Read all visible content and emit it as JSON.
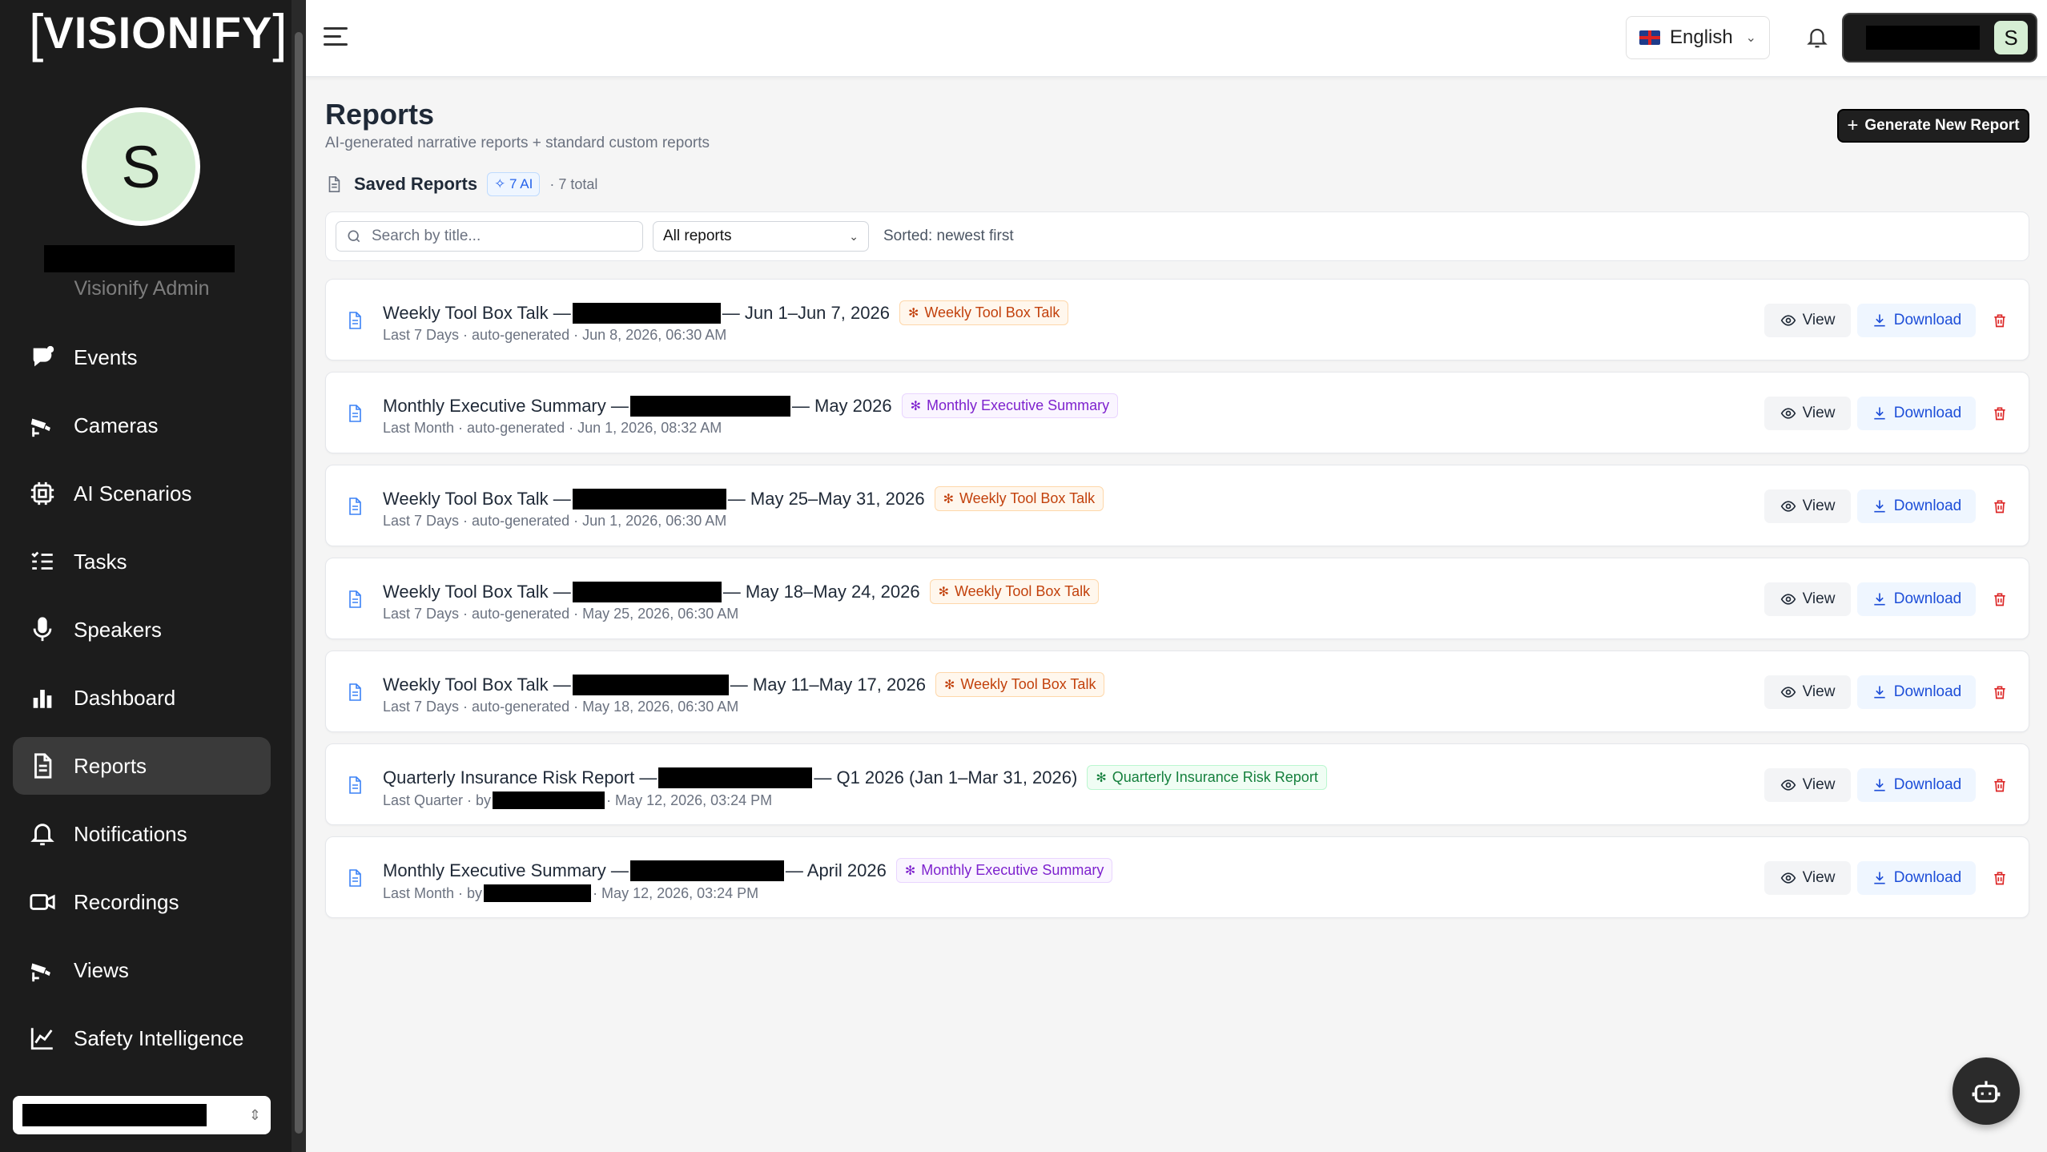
{
  "brand": {
    "logo_text": "VISIONIFY"
  },
  "user": {
    "avatar_initial": "S",
    "role": "Visionify Admin"
  },
  "sidebar": {
    "items": [
      {
        "label": "Events",
        "icon": "events-icon"
      },
      {
        "label": "Cameras",
        "icon": "camera-icon"
      },
      {
        "label": "AI Scenarios",
        "icon": "chip-icon"
      },
      {
        "label": "Tasks",
        "icon": "tasks-icon"
      },
      {
        "label": "Speakers",
        "icon": "microphone-icon"
      },
      {
        "label": "Dashboard",
        "icon": "bar-chart-icon"
      },
      {
        "label": "Reports",
        "icon": "document-icon",
        "active": true
      },
      {
        "label": "Notifications",
        "icon": "bell-icon"
      },
      {
        "label": "Recordings",
        "icon": "video-icon"
      },
      {
        "label": "Views",
        "icon": "camera-icon"
      },
      {
        "label": "Safety Intelligence",
        "icon": "line-chart-icon"
      }
    ]
  },
  "topbar": {
    "language": "English",
    "user_avatar_initial": "S"
  },
  "page": {
    "title": "Reports",
    "subtitle": "AI-generated narrative reports + standard custom reports",
    "generate_button": "Generate New Report"
  },
  "saved": {
    "title": "Saved Reports",
    "ai_count": "7 AI",
    "total": "· 7 total"
  },
  "filters": {
    "search_placeholder": "Search by title...",
    "type_select": "All reports",
    "sorted": "Sorted: newest first"
  },
  "actions": {
    "view": "View",
    "download": "Download"
  },
  "colors": {
    "sidebar_bg": "#1c1c1c",
    "orange_tag": "#c2410c",
    "purple_tag": "#7e22ce",
    "green_tag": "#15803d",
    "download_blue": "#1d4ed8",
    "delete_red": "#dc2626"
  },
  "reports": [
    {
      "title_prefix": "Weekly Tool Box Talk —",
      "title_suffix": "— Jun 1–Jun 7, 2026",
      "tag": "Weekly Tool Box Talk",
      "tag_color": "orange",
      "meta_prefix": "Last 7 Days · auto-generated · Jun 8, 2026, 06:30 AM",
      "meta_suffix": ""
    },
    {
      "title_prefix": "Monthly Executive Summary —",
      "title_suffix": "— May 2026",
      "tag": "Monthly Executive Summary",
      "tag_color": "purple",
      "meta_prefix": "Last Month · auto-generated · Jun 1, 2026, 08:32 AM",
      "meta_suffix": ""
    },
    {
      "title_prefix": "Weekly Tool Box Talk —",
      "title_suffix": "— May 25–May 31, 2026",
      "tag": "Weekly Tool Box Talk",
      "tag_color": "orange",
      "meta_prefix": "Last 7 Days · auto-generated · Jun 1, 2026, 06:30 AM",
      "meta_suffix": ""
    },
    {
      "title_prefix": "Weekly Tool Box Talk —",
      "title_suffix": "— May 18–May 24, 2026",
      "tag": "Weekly Tool Box Talk",
      "tag_color": "orange",
      "meta_prefix": "Last 7 Days · auto-generated · May 25, 2026, 06:30 AM",
      "meta_suffix": ""
    },
    {
      "title_prefix": "Weekly Tool Box Talk —",
      "title_suffix": "— May 11–May 17, 2026",
      "tag": "Weekly Tool Box Talk",
      "tag_color": "orange",
      "meta_prefix": "Last 7 Days · auto-generated · May 18, 2026, 06:30 AM",
      "meta_suffix": ""
    },
    {
      "title_prefix": "Quarterly Insurance Risk Report —",
      "title_suffix": "— Q1 2026 (Jan 1–Mar 31, 2026)",
      "tag": "Quarterly Insurance Risk Report",
      "tag_color": "green",
      "meta_prefix": "Last Quarter · by",
      "meta_suffix": "· May 12, 2026, 03:24 PM"
    },
    {
      "title_prefix": "Monthly Executive Summary —",
      "title_suffix": "— April 2026",
      "tag": "Monthly Executive Summary",
      "tag_color": "purple",
      "meta_prefix": "Last Month · by",
      "meta_suffix": "· May 12, 2026, 03:24 PM"
    }
  ]
}
